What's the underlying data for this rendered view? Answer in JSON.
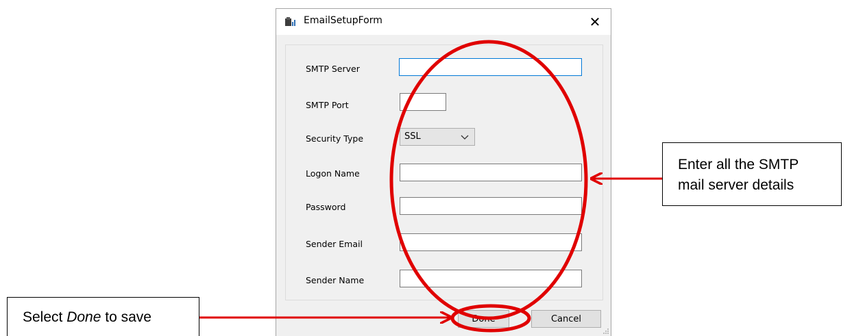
{
  "window": {
    "title": "EmailSetupForm",
    "close_glyph": "✕",
    "icon": "app-icon"
  },
  "form": {
    "smtp_server": {
      "label": "SMTP Server",
      "value": ""
    },
    "smtp_port": {
      "label": "SMTP Port",
      "value": ""
    },
    "security_type": {
      "label": "Security Type",
      "value": "SSL"
    },
    "logon_name": {
      "label": "Logon Name",
      "value": ""
    },
    "password": {
      "label": "Password",
      "value": ""
    },
    "sender_email": {
      "label": "Sender Email",
      "value": ""
    },
    "sender_name": {
      "label": "Sender Name",
      "value": ""
    }
  },
  "buttons": {
    "done": "Done",
    "cancel": "Cancel"
  },
  "annotations": {
    "smtp_callout": [
      "Enter all the SMTP",
      "mail server details"
    ],
    "done_callout": {
      "prefix": "Select ",
      "emphasis": "Done",
      "suffix": " to save"
    },
    "highlight_color": "#e00000"
  }
}
